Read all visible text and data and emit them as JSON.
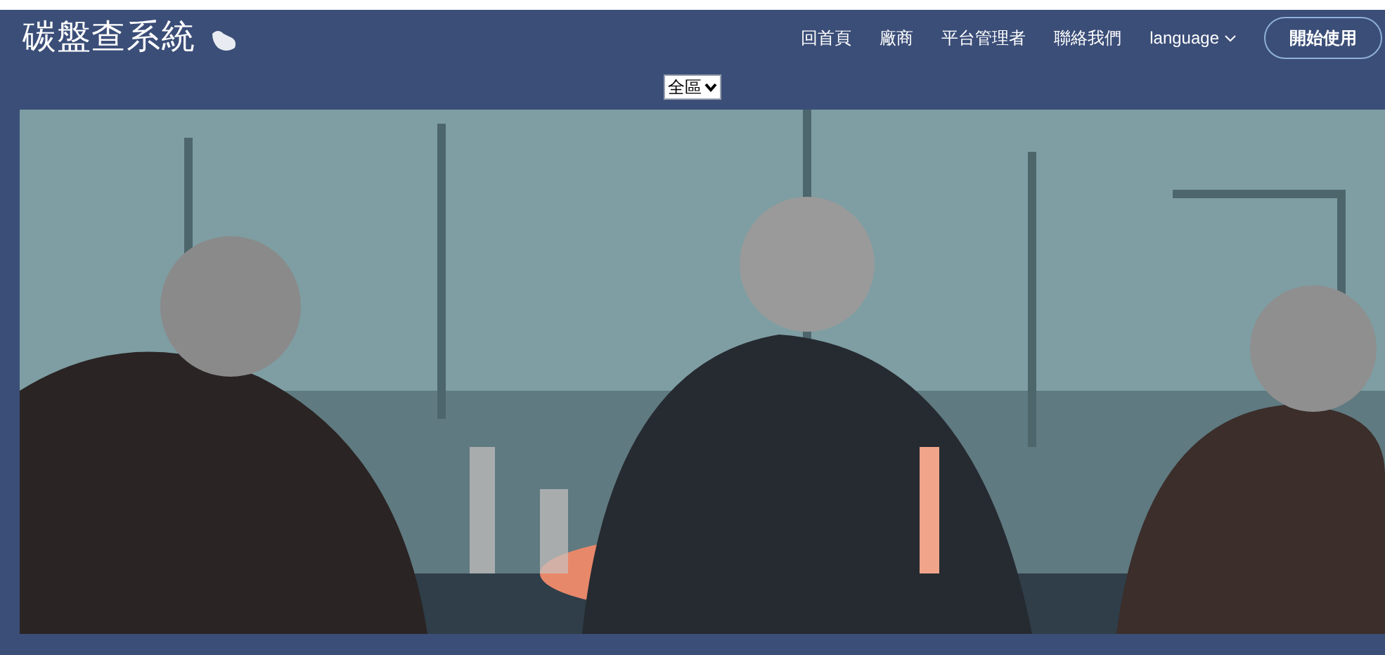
{
  "brand": {
    "title": "碳盤查系統"
  },
  "nav": [
    {
      "label": "回首頁",
      "kind": "link"
    },
    {
      "label": "廠商",
      "kind": "link"
    },
    {
      "label": "平台管理者",
      "kind": "link"
    },
    {
      "label": "聯絡我們",
      "kind": "link"
    },
    {
      "label": "language",
      "kind": "dropdown"
    }
  ],
  "cta": {
    "label": "開始使用"
  },
  "region_select": {
    "value": "全區"
  }
}
